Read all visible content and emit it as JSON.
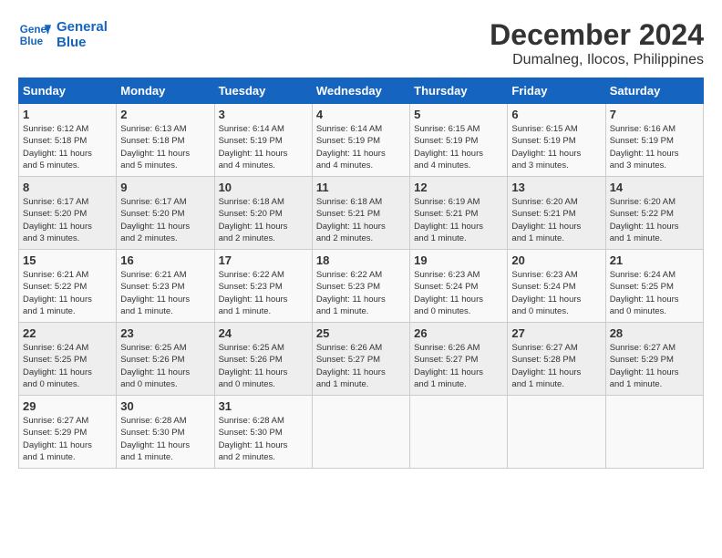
{
  "logo": {
    "line1": "General",
    "line2": "Blue"
  },
  "title": "December 2024",
  "location": "Dumalneg, Ilocos, Philippines",
  "weekdays": [
    "Sunday",
    "Monday",
    "Tuesday",
    "Wednesday",
    "Thursday",
    "Friday",
    "Saturday"
  ],
  "weeks": [
    [
      {
        "day": "1",
        "info": "Sunrise: 6:12 AM\nSunset: 5:18 PM\nDaylight: 11 hours\nand 5 minutes."
      },
      {
        "day": "2",
        "info": "Sunrise: 6:13 AM\nSunset: 5:18 PM\nDaylight: 11 hours\nand 5 minutes."
      },
      {
        "day": "3",
        "info": "Sunrise: 6:14 AM\nSunset: 5:19 PM\nDaylight: 11 hours\nand 4 minutes."
      },
      {
        "day": "4",
        "info": "Sunrise: 6:14 AM\nSunset: 5:19 PM\nDaylight: 11 hours\nand 4 minutes."
      },
      {
        "day": "5",
        "info": "Sunrise: 6:15 AM\nSunset: 5:19 PM\nDaylight: 11 hours\nand 4 minutes."
      },
      {
        "day": "6",
        "info": "Sunrise: 6:15 AM\nSunset: 5:19 PM\nDaylight: 11 hours\nand 3 minutes."
      },
      {
        "day": "7",
        "info": "Sunrise: 6:16 AM\nSunset: 5:19 PM\nDaylight: 11 hours\nand 3 minutes."
      }
    ],
    [
      {
        "day": "8",
        "info": "Sunrise: 6:17 AM\nSunset: 5:20 PM\nDaylight: 11 hours\nand 3 minutes."
      },
      {
        "day": "9",
        "info": "Sunrise: 6:17 AM\nSunset: 5:20 PM\nDaylight: 11 hours\nand 2 minutes."
      },
      {
        "day": "10",
        "info": "Sunrise: 6:18 AM\nSunset: 5:20 PM\nDaylight: 11 hours\nand 2 minutes."
      },
      {
        "day": "11",
        "info": "Sunrise: 6:18 AM\nSunset: 5:21 PM\nDaylight: 11 hours\nand 2 minutes."
      },
      {
        "day": "12",
        "info": "Sunrise: 6:19 AM\nSunset: 5:21 PM\nDaylight: 11 hours\nand 1 minute."
      },
      {
        "day": "13",
        "info": "Sunrise: 6:20 AM\nSunset: 5:21 PM\nDaylight: 11 hours\nand 1 minute."
      },
      {
        "day": "14",
        "info": "Sunrise: 6:20 AM\nSunset: 5:22 PM\nDaylight: 11 hours\nand 1 minute."
      }
    ],
    [
      {
        "day": "15",
        "info": "Sunrise: 6:21 AM\nSunset: 5:22 PM\nDaylight: 11 hours\nand 1 minute."
      },
      {
        "day": "16",
        "info": "Sunrise: 6:21 AM\nSunset: 5:23 PM\nDaylight: 11 hours\nand 1 minute."
      },
      {
        "day": "17",
        "info": "Sunrise: 6:22 AM\nSunset: 5:23 PM\nDaylight: 11 hours\nand 1 minute."
      },
      {
        "day": "18",
        "info": "Sunrise: 6:22 AM\nSunset: 5:23 PM\nDaylight: 11 hours\nand 1 minute."
      },
      {
        "day": "19",
        "info": "Sunrise: 6:23 AM\nSunset: 5:24 PM\nDaylight: 11 hours\nand 0 minutes."
      },
      {
        "day": "20",
        "info": "Sunrise: 6:23 AM\nSunset: 5:24 PM\nDaylight: 11 hours\nand 0 minutes."
      },
      {
        "day": "21",
        "info": "Sunrise: 6:24 AM\nSunset: 5:25 PM\nDaylight: 11 hours\nand 0 minutes."
      }
    ],
    [
      {
        "day": "22",
        "info": "Sunrise: 6:24 AM\nSunset: 5:25 PM\nDaylight: 11 hours\nand 0 minutes."
      },
      {
        "day": "23",
        "info": "Sunrise: 6:25 AM\nSunset: 5:26 PM\nDaylight: 11 hours\nand 0 minutes."
      },
      {
        "day": "24",
        "info": "Sunrise: 6:25 AM\nSunset: 5:26 PM\nDaylight: 11 hours\nand 0 minutes."
      },
      {
        "day": "25",
        "info": "Sunrise: 6:26 AM\nSunset: 5:27 PM\nDaylight: 11 hours\nand 1 minute."
      },
      {
        "day": "26",
        "info": "Sunrise: 6:26 AM\nSunset: 5:27 PM\nDaylight: 11 hours\nand 1 minute."
      },
      {
        "day": "27",
        "info": "Sunrise: 6:27 AM\nSunset: 5:28 PM\nDaylight: 11 hours\nand 1 minute."
      },
      {
        "day": "28",
        "info": "Sunrise: 6:27 AM\nSunset: 5:29 PM\nDaylight: 11 hours\nand 1 minute."
      }
    ],
    [
      {
        "day": "29",
        "info": "Sunrise: 6:27 AM\nSunset: 5:29 PM\nDaylight: 11 hours\nand 1 minute."
      },
      {
        "day": "30",
        "info": "Sunrise: 6:28 AM\nSunset: 5:30 PM\nDaylight: 11 hours\nand 1 minute."
      },
      {
        "day": "31",
        "info": "Sunrise: 6:28 AM\nSunset: 5:30 PM\nDaylight: 11 hours\nand 2 minutes."
      },
      {
        "day": "",
        "info": ""
      },
      {
        "day": "",
        "info": ""
      },
      {
        "day": "",
        "info": ""
      },
      {
        "day": "",
        "info": ""
      }
    ]
  ]
}
